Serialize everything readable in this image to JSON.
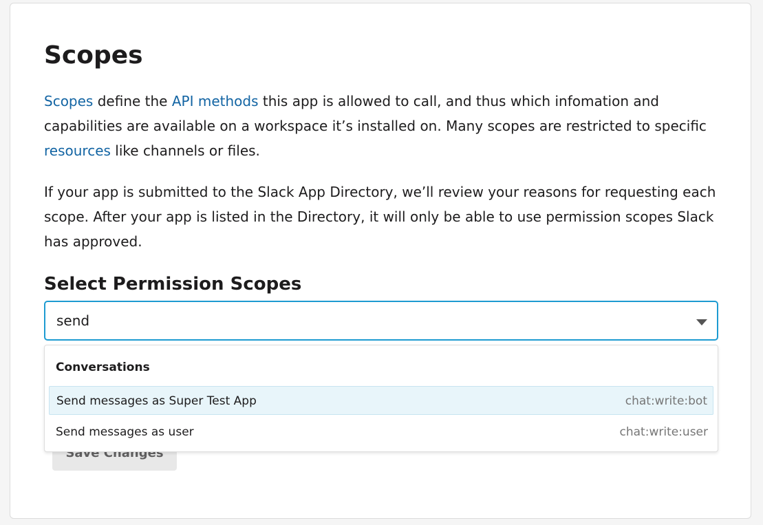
{
  "page": {
    "title": "Scopes",
    "intro": {
      "link_scopes": "Scopes",
      "text_1": " define the ",
      "link_api_methods": "API methods",
      "text_2": " this app is allowed to call, and thus which infomation and capabilities are available on a workspace it’s installed on. Many scopes are restricted to specific ",
      "link_resources": "resources",
      "text_3": " like channels or files."
    },
    "review_text": "If your app is submitted to the Slack App Directory, we’ll review your reasons for requesting each scope. After your app is listed in the Directory, it will only be able to use permission scopes Slack has approved."
  },
  "permissions": {
    "heading": "Select Permission Scopes",
    "search_value": "send",
    "dropdown_icon": "caret-down-icon",
    "dropdown": {
      "group_label": "Conversations",
      "options": [
        {
          "label": "Send messages as Super Test App",
          "scope": "chat:write:bot",
          "highlighted": true
        },
        {
          "label": "Send messages as user",
          "scope": "chat:write:user",
          "highlighted": false
        }
      ]
    }
  },
  "actions": {
    "save_label": "Save Changes"
  },
  "colors": {
    "link": "#1264a3",
    "focus_border": "#1d9bd1",
    "highlight_bg": "#e8f5fa"
  }
}
